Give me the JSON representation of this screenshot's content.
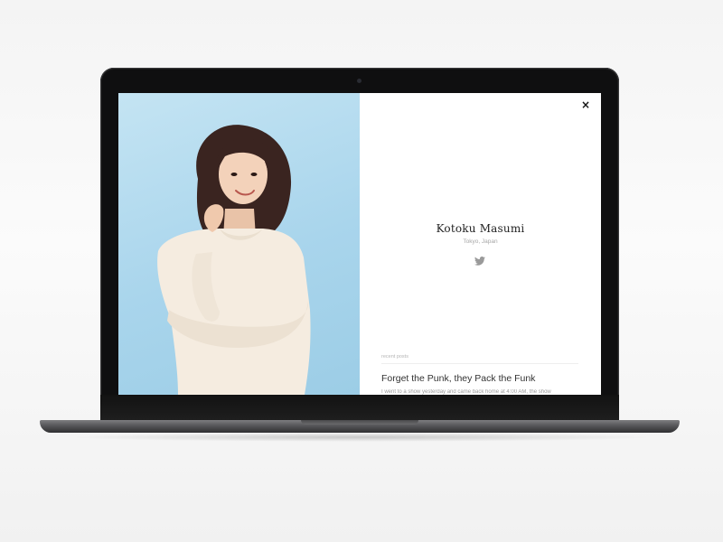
{
  "profile": {
    "name": "Kotoku Masumi",
    "location": "Tokyo, Japan",
    "social_icon": "twitter-icon"
  },
  "controls": {
    "close_label": "×",
    "close_icon": "close-icon"
  },
  "recent_posts": {
    "label": "recent posts",
    "items": [
      {
        "title": "Forget the Punk, they Pack the Funk",
        "excerpt": "I went to a show yesterday and came back home at 4:00 AM, the show"
      }
    ]
  },
  "colors": {
    "photo_background": "#a9d5ec",
    "panel_background": "#ffffff",
    "bezel": "#0f0f10",
    "name_text": "#222222",
    "muted_text": "#a7a7a7"
  }
}
